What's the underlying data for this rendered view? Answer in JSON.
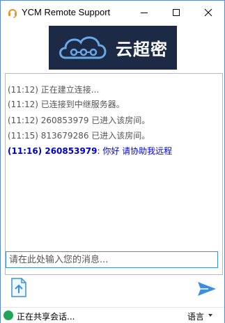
{
  "window": {
    "title": "YCM Remote Support",
    "icons": {
      "app": "headset-icon",
      "minimize": "minimize-icon",
      "maximize": "maximize-icon",
      "close": "close-icon"
    }
  },
  "logo": {
    "text": "云超密",
    "icon": "cloud-logo-icon",
    "background": "#1c2a46"
  },
  "chat": {
    "messages": [
      {
        "text": "(11:12) 正在建立连接..."
      },
      {
        "text": "(11:12) 已连接到中继服务器。"
      },
      {
        "text": "(11:12) 260853979 已进入该房间。"
      },
      {
        "text": "(11:15) 813679286 已进入该房间。"
      }
    ],
    "self_message": {
      "prefix": "(11:16) 260853979",
      "colon": ": ",
      "body": "你好  请协助我远程"
    }
  },
  "input": {
    "placeholder": "请在此处输入您的消息..."
  },
  "actions": {
    "upload_icon": "upload-file-icon",
    "send_icon": "send-icon"
  },
  "status": {
    "text": "正在共享会话...",
    "color": "#23a45a"
  },
  "language": {
    "label": "语言"
  },
  "colors": {
    "accent": "#3d8fdd",
    "self_name": "#0000cc"
  }
}
